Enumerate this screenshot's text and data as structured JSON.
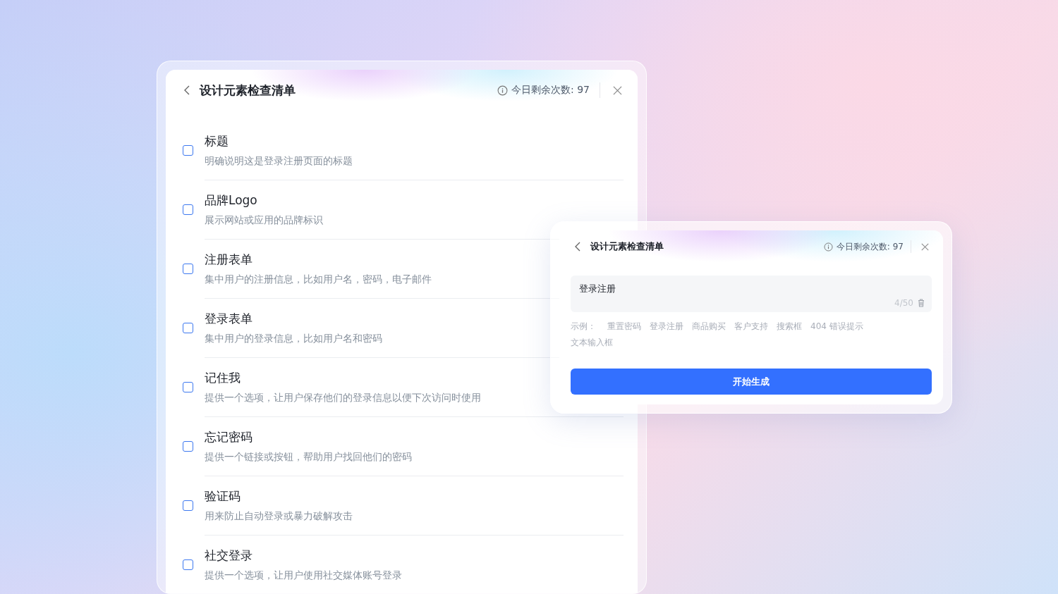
{
  "checklist": {
    "title": "设计元素检查清单",
    "remaining": "今日剩余次数: 97",
    "items": [
      {
        "title": "标题",
        "description": "明确说明这是登录注册页面的标题",
        "checked": false
      },
      {
        "title": "品牌Logo",
        "description": "展示网站或应用的品牌标识",
        "checked": false
      },
      {
        "title": "注册表单",
        "description": "集中用户的注册信息，比如用户名，密码，电子邮件",
        "checked": false
      },
      {
        "title": "登录表单",
        "description": "集中用户的登录信息，比如用户名和密码",
        "checked": false
      },
      {
        "title": "记住我",
        "description": "提供一个选项，让用户保存他们的登录信息以便下次访问时使用",
        "checked": false
      },
      {
        "title": "忘记密码",
        "description": "提供一个链接或按钮，帮助用户找回他们的密码",
        "checked": false
      },
      {
        "title": "验证码",
        "description": "用来防止自动登录或暴力破解攻击",
        "checked": false
      },
      {
        "title": "社交登录",
        "description": "提供一个选项，让用户使用社交媒体账号登录",
        "checked": false
      }
    ]
  },
  "generator": {
    "title": "设计元素检查清单",
    "remaining": "今日剩余次数: 97",
    "input": {
      "value": "登录注册",
      "counter": "4/50"
    },
    "examples_label": "示例：",
    "examples": [
      "重置密码",
      "登录注册",
      "商品购买",
      "客户支持",
      "搜索框",
      "404 错误提示",
      "文本输入框"
    ],
    "button": "开始生成"
  }
}
